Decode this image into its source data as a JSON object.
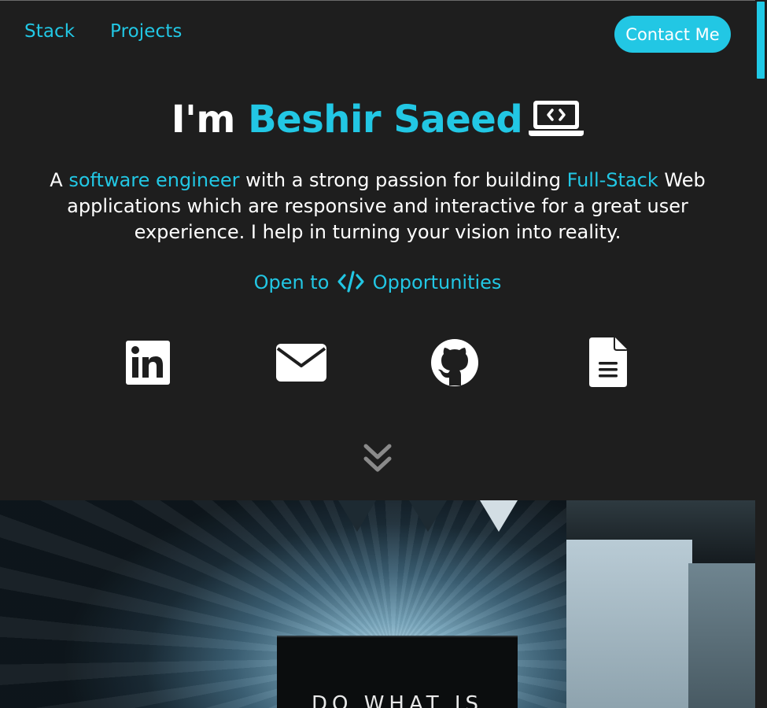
{
  "nav": {
    "links": [
      "Stack",
      "Projects"
    ],
    "contact_label": "Contact Me"
  },
  "hero": {
    "greeting": "I'm ",
    "name": "Beshir Saeed",
    "desc_prefix": "A ",
    "desc_role": "software engineer",
    "desc_mid": " with a strong passion for building ",
    "desc_stack": "Full-Stack",
    "desc_suffix": " Web applications which are responsive and interactive for a great user experience. I help in turning your vision into reality.",
    "open_prefix": "Open to",
    "open_suffix": "Opportunities"
  },
  "social": [
    {
      "icon": "linkedin-icon"
    },
    {
      "icon": "email-icon"
    },
    {
      "icon": "github-icon"
    },
    {
      "icon": "resume-icon"
    }
  ],
  "photo": {
    "frame_text": "DO WHAT IS"
  },
  "colors": {
    "background": "#1e1e1e",
    "accent": "#22c7e4",
    "text": "#ffffff"
  }
}
